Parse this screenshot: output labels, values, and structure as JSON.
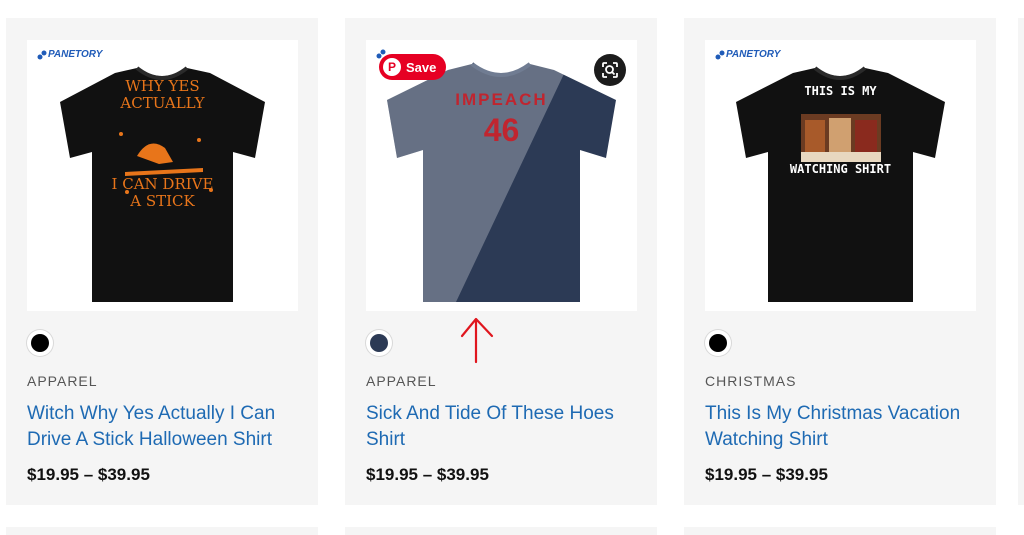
{
  "colors": {
    "card_bg": "#f5f5f5",
    "title_link": "#1e6ab3",
    "pinterest_red": "#e60023",
    "brand_blue": "#1f5bb8",
    "annotation_red": "#e0161e"
  },
  "products": [
    {
      "brand": "PANETORY",
      "shirt_lines": [
        "WHY YES",
        "ACTUALLY",
        "I CAN DRIVE",
        "A STICK"
      ],
      "shirt_color": "#111111",
      "swatch_color": "#000000",
      "category": "APPAREL",
      "title": "Witch Why Yes Actually I Can Drive A Stick Halloween Shirt",
      "price": "$19.95 – $39.95"
    },
    {
      "brand": "",
      "shirt_lines": [
        "IMPEACH",
        "46"
      ],
      "shirt_color": "#2c3a55",
      "swatch_color": "#2c3a55",
      "category": "APPAREL",
      "title": "Sick And Tide Of These Hoes Shirt",
      "price": "$19.95 – $39.95",
      "save_label": "Save",
      "pin_icon_glyph": "P",
      "lens_icon": "visual-search-icon"
    },
    {
      "brand": "PANETORY",
      "shirt_lines": [
        "THIS IS MY",
        "WATCHING SHIRT"
      ],
      "shirt_color": "#111111",
      "swatch_color": "#000000",
      "category": "CHRISTMAS",
      "title": "This Is My Christmas Vacation Watching Shirt",
      "price": "$19.95 – $39.95"
    }
  ]
}
